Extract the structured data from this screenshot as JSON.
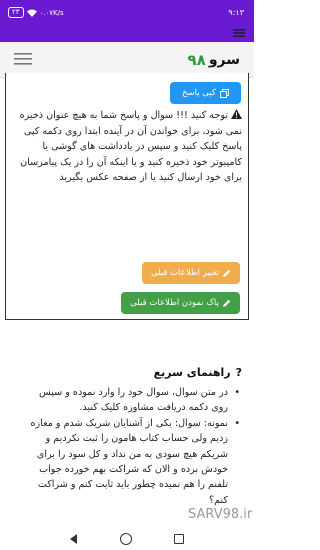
{
  "status_bar": {
    "time": "۹:۱۳",
    "battery": "۲۳",
    "speed": "۰.۰۷K/s"
  },
  "header": {
    "logo_text": "سرو",
    "logo_number": "۹۸"
  },
  "answer": {
    "copy_button": "کپی پاسخ",
    "notice": "توجه کنید !!! سوال و پاسخ شما به هیچ عنوان ذخیره نمی شود، برای خواندن آن در آینده ابتدا روی دکمه کپی پاسخ کلیک کنید و سپس در یادداشت های گوشی یا کامپیوتر خود ذخیره کنید و یا اینکه آن را در یک پیامرسان برای خود ارسال کنید یا از صفحه عکس بگیرید",
    "edit_button": "تغییر اطلاعات قبلی",
    "delete_button": "پاک نمودن اطلاعات قبلی"
  },
  "guide": {
    "title": "راهنمای سریع",
    "items": [
      "در متن سوال، سوال خود را وارد نموده و سپس روی دکمه دریافت مشاوره کلیک کنید.",
      "نمونه: سوال: یکی از آشنایان شریک شدم و مغازه زدیم ولی حساب کتاب هامون را ثبت نکردیم و شریکم هیچ سودی به من نداد و کل سود را برای خودش برده و الان که شراکت بهم خورده جواب تلفنم را هم نمیده چطور باید ثابت کنم و شراکت کنم؟"
    ]
  },
  "watermark": "SARV98.ir",
  "colors": {
    "status_bar": "#6a1bd1",
    "copy_button": "#2196f3",
    "edit_button": "#f0ad4e",
    "delete_button": "#43a047",
    "logo_number": "#2e9c3a"
  }
}
